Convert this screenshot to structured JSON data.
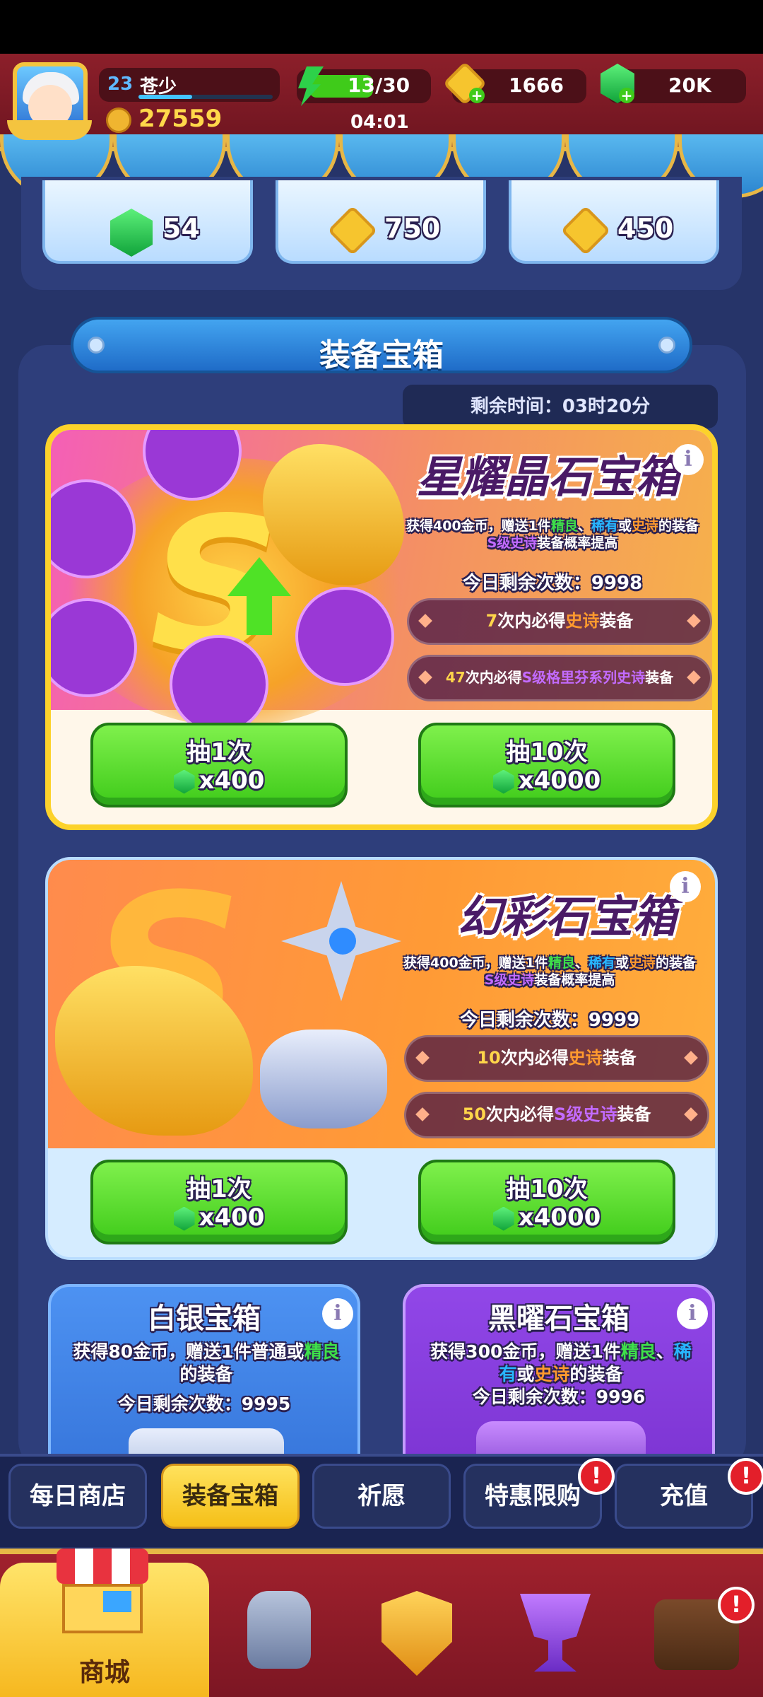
{
  "player": {
    "level": "23",
    "name": "苍少",
    "power": "27559"
  },
  "energy": {
    "value": "13/30",
    "timer": "04:01"
  },
  "currency": {
    "coins": "1666",
    "gems": "20K"
  },
  "top_offers": [
    {
      "type": "gem",
      "value": "54"
    },
    {
      "type": "coin",
      "value": "750"
    },
    {
      "type": "coin",
      "value": "450"
    }
  ],
  "section_title": "装备宝箱",
  "remaining_time": "剩余时间：03时20分",
  "chest1": {
    "title": "星耀晶石宝箱",
    "desc": {
      "p1": "获得400金币，赠送1件",
      "good": "精良",
      "sep1": "、",
      "rare": "稀有",
      "or": "或",
      "epic": "史诗",
      "p2": "的装备",
      "sepic": "S级史诗",
      "p3": "装备概率提高"
    },
    "remaining": "今日剩余次数：9998",
    "g1": {
      "n": "7",
      "t1": "次内必得",
      "h": "史诗",
      "t2": "装备"
    },
    "g2": {
      "n": "47",
      "t1": "次内必得",
      "h": "S级格里芬系列史诗",
      "t2": "装备"
    },
    "btn1": {
      "label": "抽1次",
      "cost": "x400"
    },
    "btn10": {
      "label": "抽10次",
      "cost": "x4000"
    }
  },
  "chest2": {
    "title": "幻彩石宝箱",
    "desc": {
      "p1": "获得400金币，赠送1件",
      "good": "精良",
      "sep1": "、",
      "rare": "稀有",
      "or": "或",
      "epic": "史诗",
      "p2": "的装备",
      "sepic": "S级史诗",
      "p3": "装备概率提高"
    },
    "remaining": "今日剩余次数：9999",
    "g1": {
      "n": "10",
      "t1": "次内必得",
      "h": "史诗",
      "t2": "装备"
    },
    "g2": {
      "n": "50",
      "t1": "次内必得",
      "h": "S级史诗",
      "t2": "装备"
    },
    "btn1": {
      "label": "抽1次",
      "cost": "x400"
    },
    "btn10": {
      "label": "抽10次",
      "cost": "x4000"
    }
  },
  "chest3": {
    "title": "白银宝箱",
    "desc1": "获得80金币，赠送1件普通或",
    "good": "精良",
    "desc2": "的装备",
    "remaining": "今日剩余次数：9995"
  },
  "chest4": {
    "title": "黑曜石宝箱",
    "desc1": "获得300金币，赠送1件",
    "good": "精良",
    "sep": "、",
    "rare1": "稀",
    "rare2": "有",
    "or": "或",
    "epic": "史诗",
    "desc2": "的装备",
    "remaining": "今日剩余次数：9996"
  },
  "tabs": [
    {
      "label": "每日商店",
      "badge": ""
    },
    {
      "label": "装备宝箱",
      "badge": ""
    },
    {
      "label": "祈愿",
      "badge": ""
    },
    {
      "label": "特惠限购",
      "badge": "!"
    },
    {
      "label": "充值",
      "badge": "!"
    }
  ],
  "bottom_nav": {
    "shop_label": "商城",
    "badge": "!"
  },
  "info_glyph": "i",
  "colors": {
    "accent_yellow": "#fcd22b",
    "green_button": "#4fd626",
    "panel": "#2e3e7b",
    "topbar": "#8c1f2a"
  }
}
